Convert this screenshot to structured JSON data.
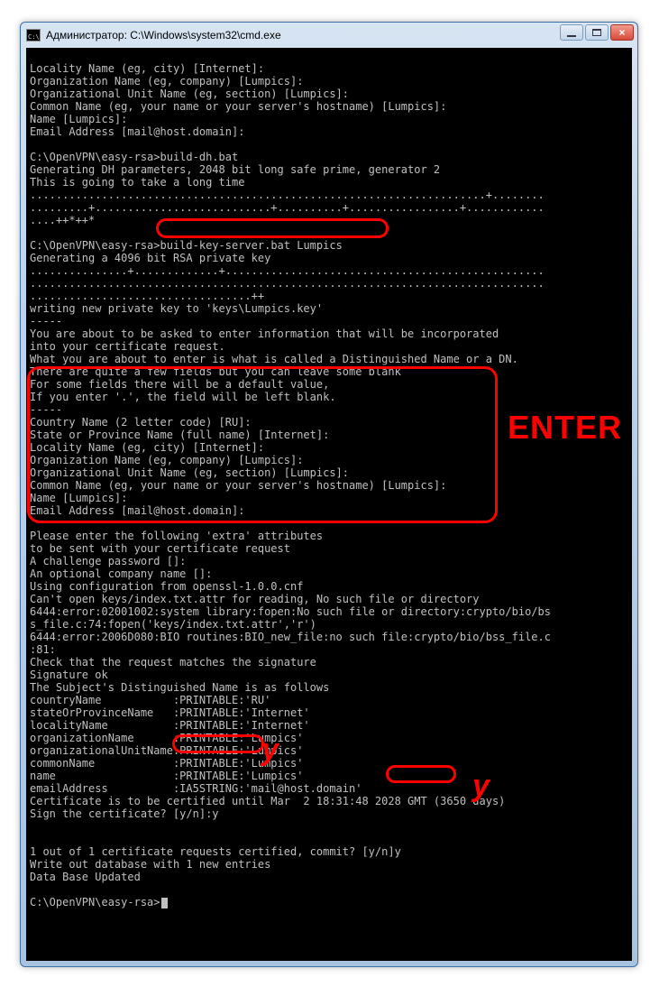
{
  "window": {
    "title": "Администратор: C:\\Windows\\system32\\cmd.exe"
  },
  "term": {
    "l1": "Locality Name (eg, city) [Internet]:",
    "l2": "Organization Name (eg, company) [Lumpics]:",
    "l3": "Organizational Unit Name (eg, section) [Lumpics]:",
    "l4": "Common Name (eg, your name or your server's hostname) [Lumpics]:",
    "l5": "Name [Lumpics]:",
    "l6": "Email Address [mail@host.domain]:",
    "blank": "",
    "l7": "C:\\OpenVPN\\easy-rsa>build-dh.bat",
    "l8": "Generating DH parameters, 2048 bit long safe prime, generator 2",
    "l9": "This is going to take a long time",
    "dots1": "......................................................................+........",
    "dots2": ".........+...........................+..........+.................+............",
    "dots3": "....++*++*",
    "l10a": "C:\\OpenVPN\\easy-rsa>",
    "l10b": "build-key-server.bat Lumpics",
    "l11": "Generating a 4096 bit RSA private key",
    "dots4": "...............+.............+.................................................",
    "dots5": "...............................................................................",
    "dots6": "..................................++",
    "l12": "writing new private key to 'keys\\Lumpics.key'",
    "dash": "-----",
    "l13": "You are about to be asked to enter information that will be incorporated",
    "l14": "into your certificate request.",
    "l15": "What you are about to enter is what is called a Distinguished Name or a DN.",
    "l16": "There are quite a few fields but you can leave some blank",
    "l17": "For some fields there will be a default value,",
    "l18": "If you enter '.', the field will be left blank.",
    "l19": "Country Name (2 letter code) [RU]:",
    "l20": "State or Province Name (full name) [Internet]:",
    "l21": "Locality Name (eg, city) [Internet]:",
    "l22": "Organization Name (eg, company) [Lumpics]:",
    "l23": "Organizational Unit Name (eg, section) [Lumpics]:",
    "l24": "Common Name (eg, your name or your server's hostname) [Lumpics]:",
    "l25": "Name [Lumpics]:",
    "l26": "Email Address [mail@host.domain]:",
    "l27": "Please enter the following 'extra' attributes",
    "l28": "to be sent with your certificate request",
    "l29": "A challenge password []:",
    "l30": "An optional company name []:",
    "l31": "Using configuration from openssl-1.0.0.cnf",
    "l32": "Can't open keys/index.txt.attr for reading, No such file or directory",
    "l33": "6444:error:02001002:system library:fopen:No such file or directory:crypto/bio/bs",
    "l34": "s_file.c:74:fopen('keys/index.txt.attr','r')",
    "l35": "6444:error:2006D080:BIO routines:BIO_new_file:no such file:crypto/bio/bss_file.c",
    "l36": ":81:",
    "l37": "Check that the request matches the signature",
    "l38": "Signature ok",
    "l39": "The Subject's Distinguished Name is as follows",
    "l40": "countryName           :PRINTABLE:'RU'",
    "l41": "stateOrProvinceName   :PRINTABLE:'Internet'",
    "l42": "localityName          :PRINTABLE:'Internet'",
    "l43": "organizationName      :PRINTABLE:'Lumpics'",
    "l44": "organizationalUnitName:PRINTABLE:'Lumpics'",
    "l45": "commonName            :PRINTABLE:'Lumpics'",
    "l46": "name                  :PRINTABLE:'Lumpics'",
    "l47": "emailAddress          :IA5STRING:'mail@host.domain'",
    "l48": "Certificate is to be certified until Mar  2 18:31:48 2028 GMT (3650 days)",
    "l49a": "Sign the certificate?",
    "l49b": " [y/n]:y",
    "l50a": "1 out of 1 certificate requests certified, commit?",
    "l50b": " [y/n]y",
    "l51": "Write out database with 1 new entries",
    "l52": "Data Base Updated",
    "prompt": "C:\\OpenVPN\\easy-rsa>"
  },
  "anno": {
    "enter": "ENTER",
    "y": "y"
  }
}
